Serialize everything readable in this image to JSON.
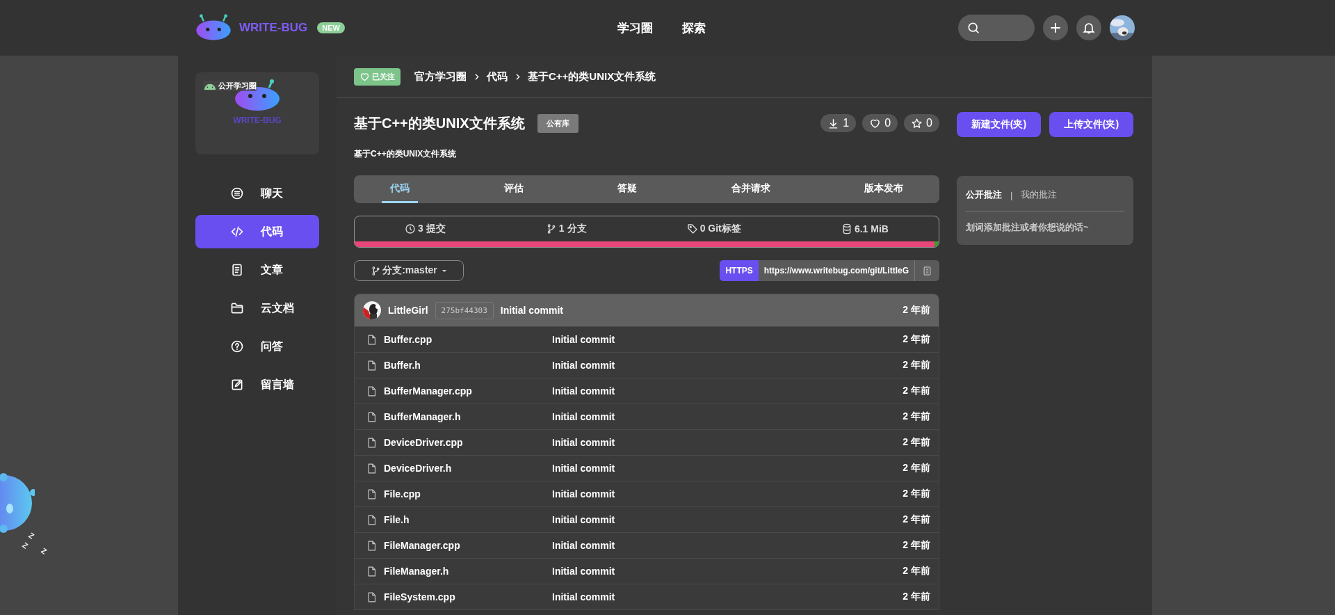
{
  "header": {
    "logo": "WRITE-BUG",
    "badge": "NEW",
    "nav": [
      {
        "label": "学习圈"
      },
      {
        "label": "探索"
      }
    ]
  },
  "sidebar": {
    "cover": {
      "badge": "公开学习圈",
      "name": "WRITE-BUG"
    },
    "items": [
      {
        "label": "聊天",
        "kind": "chat",
        "selected": false
      },
      {
        "label": "代码",
        "kind": "code",
        "selected": true
      },
      {
        "label": "文章",
        "kind": "article",
        "selected": false
      },
      {
        "label": "云文档",
        "kind": "folder",
        "selected": false
      },
      {
        "label": "问答",
        "kind": "question",
        "selected": false
      },
      {
        "label": "留言墙",
        "kind": "edit",
        "selected": false
      }
    ]
  },
  "breadcrumb": {
    "follow": "已关注",
    "path": [
      "官方学习圈",
      "代码",
      "基于C++的类UNIX文件系统"
    ]
  },
  "repo": {
    "title": "基于C++的类UNIX文件系统",
    "visibility": "公有库",
    "description": "基于C++的类UNIX文件系统",
    "counters": [
      {
        "kind": "download",
        "value": "1"
      },
      {
        "kind": "heart",
        "value": "0"
      },
      {
        "kind": "star",
        "value": "0"
      }
    ]
  },
  "tabs": [
    {
      "label": "代码",
      "selected": true
    },
    {
      "label": "评估",
      "selected": false
    },
    {
      "label": "答疑",
      "selected": false
    },
    {
      "label": "合并请求",
      "selected": false
    },
    {
      "label": "版本发布",
      "selected": false
    }
  ],
  "stats": [
    {
      "kind": "clock",
      "text": "3 提交"
    },
    {
      "kind": "branch",
      "text": "1 分支"
    },
    {
      "kind": "tag",
      "text": "0 Git标签"
    },
    {
      "kind": "database",
      "text": "6.1 MiB"
    }
  ],
  "languages": [
    {
      "color": "#e8457a",
      "level": 0.993
    },
    {
      "color": "#3f9b2c",
      "level": 0.007
    }
  ],
  "branch": "分支:master",
  "clone": {
    "protocol": "HTTPS",
    "url": "https://www.writebug.com/git/LittleG"
  },
  "commit": {
    "author": "LittleGirl",
    "hash": "275bf44303",
    "message": "Initial commit",
    "time": "2 年前"
  },
  "files": [
    {
      "name": "Buffer.cpp",
      "message": "Initial commit",
      "time": "2 年前"
    },
    {
      "name": "Buffer.h",
      "message": "Initial commit",
      "time": "2 年前"
    },
    {
      "name": "BufferManager.cpp",
      "message": "Initial commit",
      "time": "2 年前"
    },
    {
      "name": "BufferManager.h",
      "message": "Initial commit",
      "time": "2 年前"
    },
    {
      "name": "DeviceDriver.cpp",
      "message": "Initial commit",
      "time": "2 年前"
    },
    {
      "name": "DeviceDriver.h",
      "message": "Initial commit",
      "time": "2 年前"
    },
    {
      "name": "File.cpp",
      "message": "Initial commit",
      "time": "2 年前"
    },
    {
      "name": "File.h",
      "message": "Initial commit",
      "time": "2 年前"
    },
    {
      "name": "FileManager.cpp",
      "message": "Initial commit",
      "time": "2 年前"
    },
    {
      "name": "FileManager.h",
      "message": "Initial commit",
      "time": "2 年前"
    },
    {
      "name": "FileSystem.cpp",
      "message": "Initial commit",
      "time": "2 年前"
    }
  ],
  "actions": [
    "新建文件(夹)",
    "上传文件(夹)"
  ],
  "annotations": {
    "tabs": [
      {
        "label": "公开批注",
        "selected": true
      },
      {
        "label": "我的批注",
        "selected": false
      }
    ],
    "separator": "|",
    "placeholder": "划词添加批注或者你想说的话~"
  },
  "mascot": {
    "snore": [
      "Z",
      "Z",
      "Z"
    ]
  }
}
